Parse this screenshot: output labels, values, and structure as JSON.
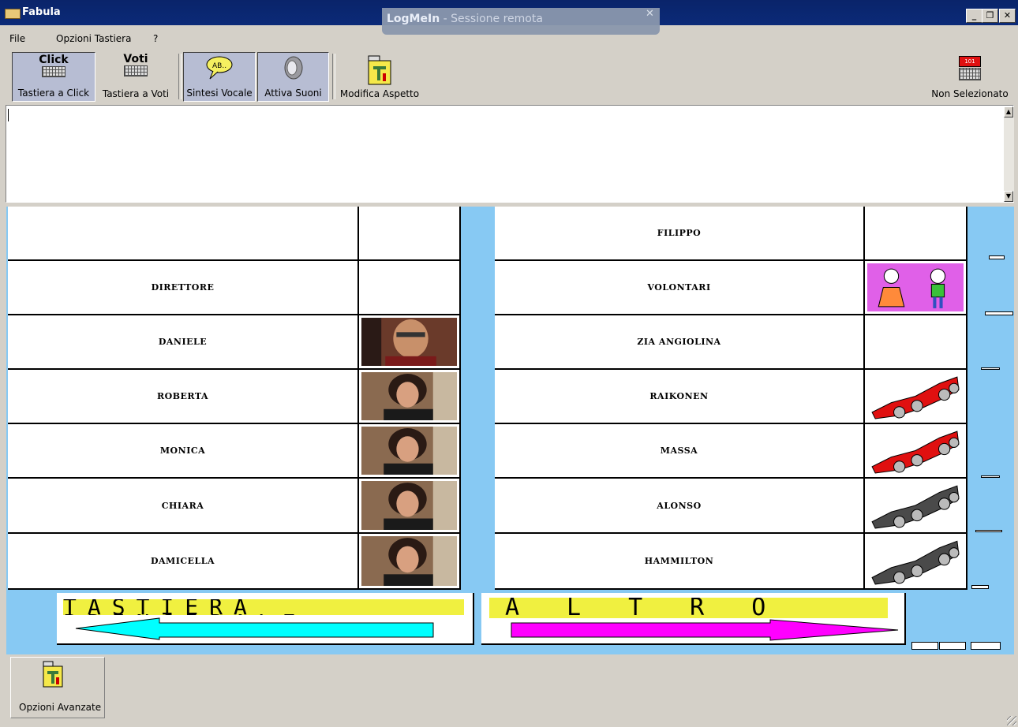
{
  "window": {
    "title": "Fabula",
    "controls": [
      "_",
      "❐",
      "✕"
    ]
  },
  "overlay": {
    "brand": "LogMeIn",
    "subtitle": " - Sessione remota",
    "close": "✕"
  },
  "menu": [
    "File",
    "Opzioni Tastiera",
    "?"
  ],
  "toolbar": {
    "click_big": "Click",
    "click_label": "Tastiera a Click",
    "voti_big": "Voti",
    "voti_label": "Tastiera a Voti",
    "sintesi_label": "Sintesi Vocale",
    "speech_bubble_text": "AB..",
    "suoni_label": "Attiva Suoni",
    "modifica_label": "Modifica Aspetto",
    "non_sel_label": "Non Selezionato",
    "non_sel_badge": "101"
  },
  "left_grid": {
    "rows": [
      {
        "label": "",
        "image": ""
      },
      {
        "label": "DIRETTORE",
        "image": ""
      },
      {
        "label": "DANIELE",
        "image": "man-photo"
      },
      {
        "label": "ROBERTA",
        "image": "woman-photo"
      },
      {
        "label": "MONICA",
        "image": "woman-photo"
      },
      {
        "label": "CHIARA",
        "image": "woman-photo"
      },
      {
        "label": "DAMICELLA",
        "image": "woman-photo"
      }
    ]
  },
  "right_grid": {
    "rows": [
      {
        "label": "FILIPPO",
        "image": ""
      },
      {
        "label": "VOLONTARI",
        "image": "kids-cartoon"
      },
      {
        "label": "ZIA ANGIOLINA",
        "image": ""
      },
      {
        "label": "RAIKONEN",
        "image": "red-race-car"
      },
      {
        "label": "MASSA",
        "image": "red-race-car"
      },
      {
        "label": "ALONSO",
        "image": "gray-race-car"
      },
      {
        "label": "HAMMILTON",
        "image": "gray-race-car"
      }
    ]
  },
  "nav": {
    "back_text": "TASTIERA PRINCIPALE",
    "next_text": "ALTRO"
  },
  "footer": {
    "advanced_label": "Opzioni Avanzate"
  },
  "colors": {
    "grid_bg": "#87c9f3",
    "titlebar": "#0a246a",
    "back_arrow": "#00ffff",
    "next_arrow": "#ff00ff",
    "banner_yellow": "#f0f040"
  }
}
